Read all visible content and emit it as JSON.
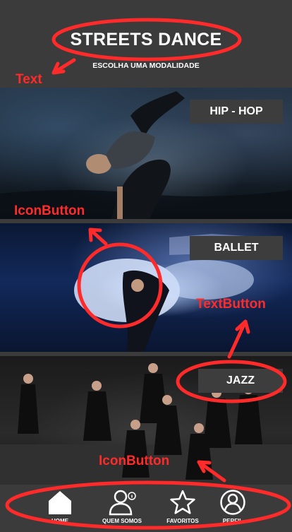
{
  "header": {
    "title": "STREETS DANCE",
    "subtitle": "ESCOLHA UMA MODALIDADE"
  },
  "cards": [
    {
      "label": "HIP - HOP"
    },
    {
      "label": "BALLET"
    },
    {
      "label": "JAZZ"
    }
  ],
  "bottom_nav": {
    "items": [
      {
        "label": "HOME",
        "icon": "home-icon"
      },
      {
        "label": "QUEM SOMOS",
        "icon": "user-info-icon"
      },
      {
        "label": "FAVORITOS",
        "icon": "star-icon"
      },
      {
        "label": "PERFIL",
        "icon": "profile-icon"
      }
    ]
  },
  "annotations": {
    "text_label": "Text",
    "iconbutton_label_1": "IconButton",
    "textbutton_label": "TextButton",
    "iconbutton_label_2": "IconButton"
  },
  "colors": {
    "background": "#3b3b3b",
    "label_background": "#3d3d3d",
    "annotation": "#ff2a2a"
  }
}
